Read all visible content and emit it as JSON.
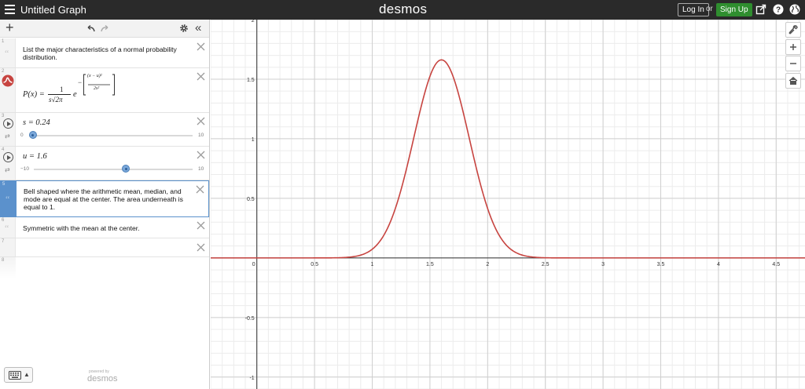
{
  "topbar": {
    "title": "Untitled Graph",
    "logo": "desmos",
    "login_label": "Log In",
    "or_label": "or",
    "signup_label": "Sign Up",
    "icons": [
      "menu-icon",
      "share-icon",
      "help-icon",
      "globe-icon"
    ]
  },
  "toolbar": {
    "add_label": "+",
    "undo_icon": "undo-icon",
    "redo_icon": "redo-icon",
    "settings_icon": "gear-icon",
    "collapse_label": "«"
  },
  "expressions": [
    {
      "num": "1",
      "text": "List the major characteristics of a normal probability distribution."
    },
    {
      "num": "2",
      "lhs": "P(x) =",
      "numerator": "1",
      "denominator": "s√2π",
      "base": "e",
      "exp_num": "(x − u)²",
      "exp_den": "2s²"
    },
    {
      "num": "3",
      "text": "s = 0.24",
      "min": "0",
      "max": "10",
      "value": 0.24,
      "lo": 0,
      "hi": 10
    },
    {
      "num": "4",
      "text": "u = 1.6",
      "min": "−10",
      "max": "10",
      "value": 1.6,
      "lo": -10,
      "hi": 10
    },
    {
      "num": "5",
      "text": "Bell shaped where the arithmetic mean, median, and mode are equal at the center.  The area underneath is equal to 1."
    },
    {
      "num": "6",
      "text": "Symmetric with the mean at the center."
    },
    {
      "num": "7",
      "text": ""
    },
    {
      "num": "8",
      "text": ""
    }
  ],
  "footer": {
    "keyboard_icon": "keyboard-icon",
    "powered_label": "powered by",
    "powered_logo": "desmos"
  },
  "graph_controls": [
    "wrench-icon",
    "zoom-in-icon",
    "zoom-out-icon",
    "home-icon"
  ],
  "chart_data": {
    "type": "line",
    "xlim": [
      -0.4,
      4.75
    ],
    "ylim": [
      -1.1,
      2.0
    ],
    "x_ticks": [
      0,
      0.5,
      1,
      1.5,
      2,
      2.5,
      3,
      3.5,
      4,
      4.5
    ],
    "x_tick_labels": [
      "0",
      "0.5",
      "1",
      "1.5",
      "2",
      "2.5",
      "3",
      "3.5",
      "4",
      "4.5"
    ],
    "y_ticks": [
      2,
      1.5,
      1,
      0.5,
      -0.5,
      -1
    ],
    "y_tick_labels": [
      "2",
      "1.5",
      "1",
      "0.5",
      "-0.5",
      "-1"
    ],
    "grid": true,
    "series": [
      {
        "function": "normal_pdf",
        "mean": 1.6,
        "sd": 0.24,
        "color": "#c74440"
      }
    ],
    "peak": {
      "x": 1.6,
      "y": 1.66
    }
  }
}
